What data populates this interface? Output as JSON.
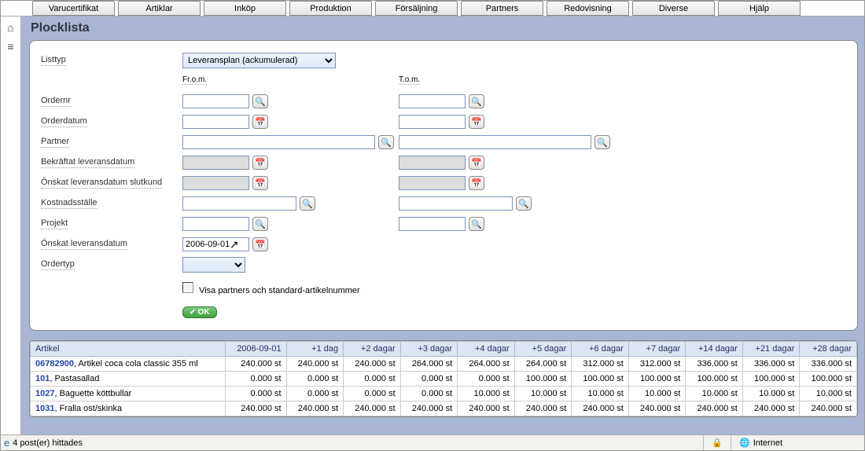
{
  "tabs": [
    "Varucertifikat",
    "Artiklar",
    "Inköp",
    "Produktion",
    "Försäljning",
    "Partners",
    "Redovisning",
    "Diverse",
    "Hjälp"
  ],
  "title": "Plocklista",
  "form": {
    "listtyp_label": "Listtyp",
    "listtyp_value": "Leveransplan (ackumulerad)",
    "from_label": "Fr.o.m.",
    "tom_label": "T.o.m.",
    "ordernr_label": "Ordernr",
    "orderdatum_label": "Orderdatum",
    "partner_label": "Partner",
    "bekraftat_label": "Bekräftat leveransdatum",
    "onskat_slutkund_label": "Önskat leveransdatum slutkund",
    "kostnad_label": "Kostnadsställe",
    "projekt_label": "Projekt",
    "onskat_label": "Önskat leveransdatum",
    "onskat_value": "2006-09-01",
    "ordertyp_label": "Ordertyp",
    "checkbox_label": "Visa partners och standard-artikelnummer",
    "ok_label": "OK"
  },
  "table": {
    "headers": [
      "Artikel",
      "2006-09-01",
      "+1 dag",
      "+2 dagar",
      "+3 dagar",
      "+4 dagar",
      "+5 dagar",
      "+6 dagar",
      "+7 dagar",
      "+14 dagar",
      "+21 dagar",
      "+28 dagar"
    ],
    "rows": [
      {
        "code": "06782900",
        "name": "Artikel coca cola classic 355 ml",
        "vals": [
          "240.000 st",
          "240.000 st",
          "240.000 st",
          "264.000 st",
          "264.000 st",
          "264.000 st",
          "312.000 st",
          "312.000 st",
          "336.000 st",
          "336.000 st",
          "336.000 st"
        ]
      },
      {
        "code": "101",
        "name": "Pastasallad",
        "vals": [
          "0.000 st",
          "0.000 st",
          "0.000 st",
          "0.000 st",
          "0.000 st",
          "100.000 st",
          "100.000 st",
          "100.000 st",
          "100.000 st",
          "100.000 st",
          "100.000 st"
        ]
      },
      {
        "code": "1027",
        "name": "Baguette köttbullar",
        "vals": [
          "0.000 st",
          "0.000 st",
          "0.000 st",
          "0.000 st",
          "10.000 st",
          "10.000 st",
          "10.000 st",
          "10.000 st",
          "10.000 st",
          "10.000 st",
          "10.000 st"
        ]
      },
      {
        "code": "1031",
        "name": "Fralla ost/skinka",
        "vals": [
          "240.000 st",
          "240.000 st",
          "240.000 st",
          "240.000 st",
          "240.000 st",
          "240.000 st",
          "240.000 st",
          "240.000 st",
          "240.000 st",
          "240.000 st",
          "240.000 st"
        ]
      }
    ]
  },
  "status": {
    "message": "4 post(er) hittades",
    "zone": "Internet"
  }
}
